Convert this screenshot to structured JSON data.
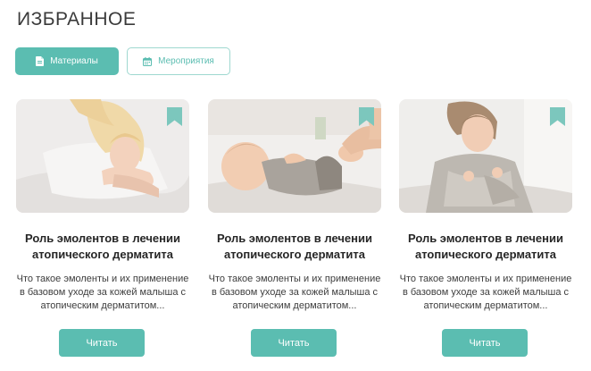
{
  "page": {
    "title": "ИЗБРАННОЕ"
  },
  "tabs": [
    {
      "label": "Материалы",
      "icon": "document-icon",
      "active": true
    },
    {
      "label": "Мероприятия",
      "icon": "calendar-icon",
      "active": false
    }
  ],
  "cards": [
    {
      "title": "Роль эмолентов в лечении атопического дерматита",
      "description": "Что такое эмоленты и их применение в базовом уходе за кожей малыша с атопическим дерматитом...",
      "button": "Читать",
      "image": "girl-lying-on-white-bed-photo"
    },
    {
      "title": "Роль эмолентов в лечении атопического дерматита",
      "description": "Что такое эмоленты и их применение в базовом уходе за кожей малыша с атопическим дерматитом...",
      "button": "Читать",
      "image": "baby-on-back-photo"
    },
    {
      "title": "Роль эмолентов в лечении атопического дерматита",
      "description": "Что такое эмоленты и их применение в базовом уходе за кожей малыша с атопическим дерматитом...",
      "button": "Читать",
      "image": "girl-in-knit-sweater-photo"
    }
  ],
  "colors": {
    "accent": "#5bbdb1",
    "accent_light": "#9fd8d0",
    "bookmark": "#7cc7bd"
  }
}
